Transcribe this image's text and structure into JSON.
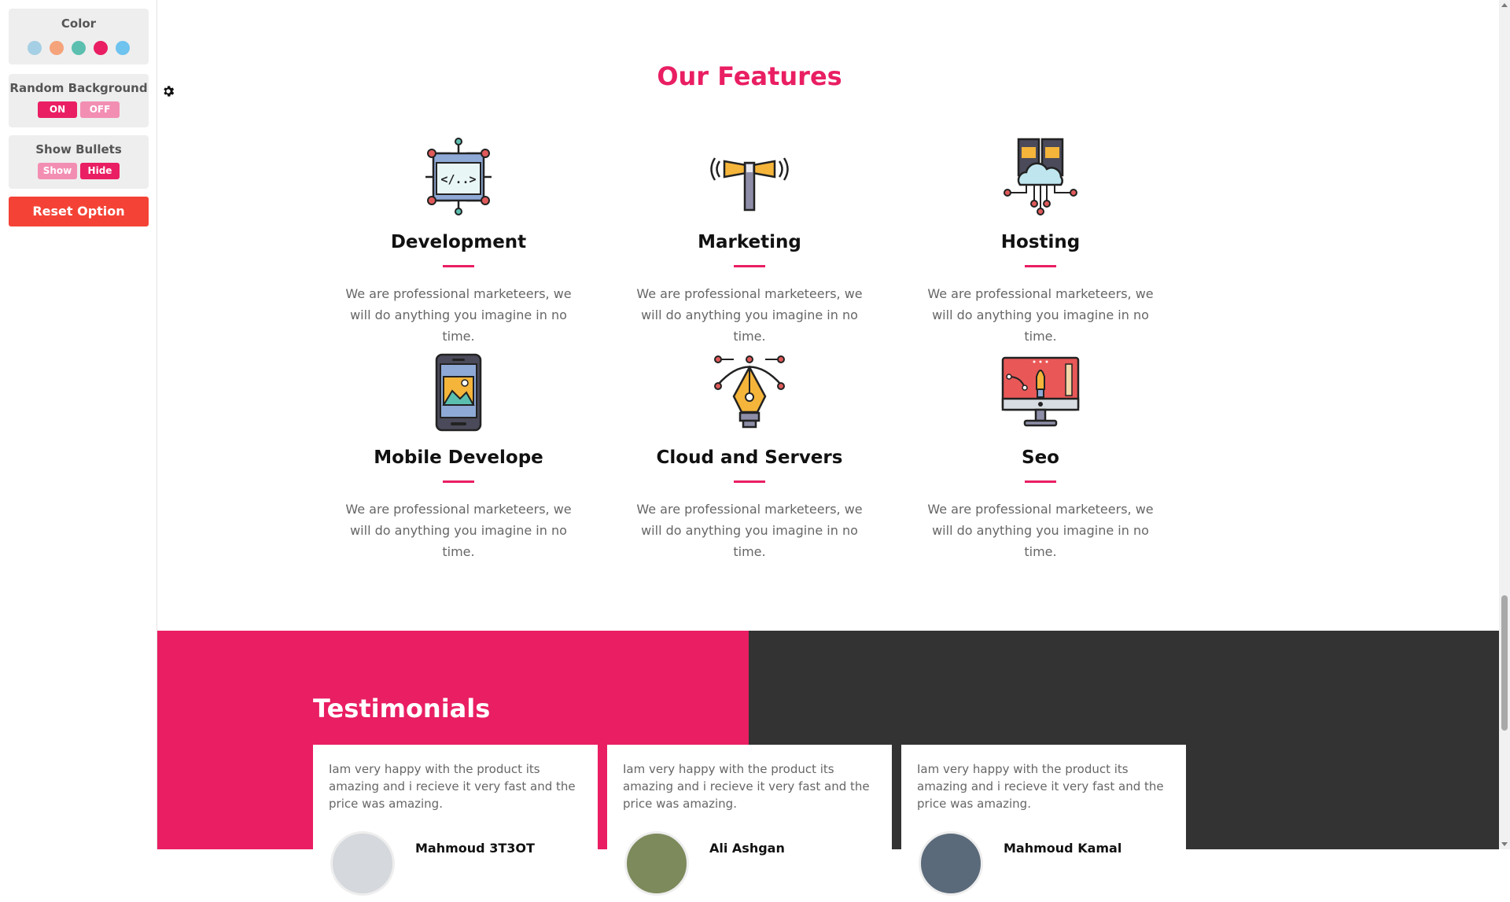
{
  "settings": {
    "color_label": "Color",
    "swatches": [
      "#a5cfe4",
      "#f5a37a",
      "#5bbfb0",
      "#e91e63",
      "#6ec3ef"
    ],
    "random_bg_label": "Random Background",
    "random_on": "ON",
    "random_off": "OFF",
    "bullets_label": "Show Bullets",
    "bullets_show": "Show",
    "bullets_hide": "Hide",
    "reset_label": "Reset Option"
  },
  "features": {
    "title": "Our Features",
    "items": [
      {
        "title": "Development",
        "text": "We are professional marketeers, we will do anything you imagine in no time.",
        "icon": "development-icon"
      },
      {
        "title": "Marketing",
        "text": "We are professional marketeers, we will do anything you imagine in no time.",
        "icon": "megaphone-icon"
      },
      {
        "title": "Hosting",
        "text": "We are professional marketeers, we will do anything you imagine in no time.",
        "icon": "cloud-server-icon"
      },
      {
        "title": "Mobile Develope",
        "text": "We are professional marketeers, we will do anything you imagine in no time.",
        "icon": "mobile-icon"
      },
      {
        "title": "Cloud and Servers",
        "text": "We are professional marketeers, we will do anything you imagine in no time.",
        "icon": "pen-tool-icon"
      },
      {
        "title": "Seo",
        "text": "We are professional marketeers, we will do anything you imagine in no time.",
        "icon": "monitor-design-icon"
      }
    ]
  },
  "testimonials": {
    "title": "Testimonials",
    "items": [
      {
        "text": "Iam very happy with the product its amazing and i recieve it very fast and the price was amazing.",
        "name": "Mahmoud 3T3OT"
      },
      {
        "text": "Iam very happy with the product its amazing and i recieve it very fast and the price was amazing.",
        "name": "Ali Ashgan"
      },
      {
        "text": "Iam very happy with the product its amazing and i recieve it very fast and the price was amazing.",
        "name": "Mahmoud Kamal"
      }
    ]
  },
  "colors": {
    "accent": "#e91e63",
    "dark": "#333333",
    "reset": "#f44336"
  }
}
